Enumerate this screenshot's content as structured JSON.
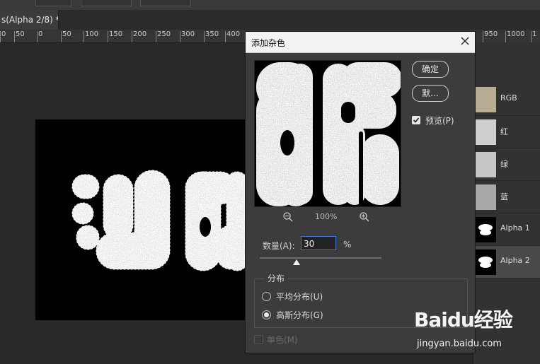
{
  "document_tab": {
    "title": "s(Alpha 2/8) *",
    "close": "×"
  },
  "ruler": {
    "labels": [
      "0",
      "50",
      "0",
      "50",
      "100",
      "150",
      "200",
      "250",
      "300",
      "350",
      "400",
      "950",
      "1000",
      "1"
    ]
  },
  "channels": [
    {
      "label": "RGB",
      "thumb_color": "#b6ad93"
    },
    {
      "label": "红",
      "thumb_color": "#cfcfcf"
    },
    {
      "label": "绿",
      "thumb_color": "#c6c6c6"
    },
    {
      "label": "蓝",
      "thumb_color": "#a9a9a9"
    },
    {
      "label": "Alpha 1",
      "thumb_color": "#000000"
    },
    {
      "label": "Alpha 2",
      "thumb_color": "#000000",
      "selected": true
    }
  ],
  "dialog": {
    "title": "添加杂色",
    "ok_label": "确定",
    "default_label": "默...",
    "preview_label": "预览(P)",
    "preview_checked": true,
    "zoom_percent": "100%",
    "amount_label": "数量(A):",
    "amount_value": "30",
    "amount_unit": "%",
    "amount_slider_fraction": 0.3,
    "distribution": {
      "legend": "分布",
      "options": [
        {
          "label": "平均分布(U)",
          "selected": false
        },
        {
          "label": "高斯分布(G)",
          "selected": true
        }
      ]
    },
    "monochrome_label": "单色(M)",
    "monochrome_checked": false
  },
  "watermark": {
    "brand": "Baidu经验",
    "url": "jingyan.baidu.com"
  }
}
